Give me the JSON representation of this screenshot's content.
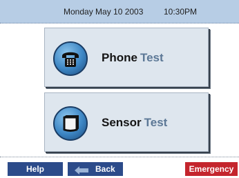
{
  "header": {
    "date": "Monday May 10  2003",
    "time": "10:30PM"
  },
  "tests": {
    "phone": {
      "label_strong": "Phone",
      "label_light": "Test",
      "icon": "telephone-icon"
    },
    "sensor": {
      "label_strong": "Sensor",
      "label_light": "Test",
      "icon": "sensor-icon"
    }
  },
  "footer": {
    "help_label": "Help",
    "back_label": "Back",
    "back_icon": "arrow-left-icon",
    "emergency_label": "Emergency"
  },
  "colors": {
    "header_bg": "#b7cde5",
    "button_face": "#dee6ee",
    "nav_blue": "#2c4b8a",
    "emergency_red": "#c4252d",
    "label_accent": "#5c7896"
  }
}
